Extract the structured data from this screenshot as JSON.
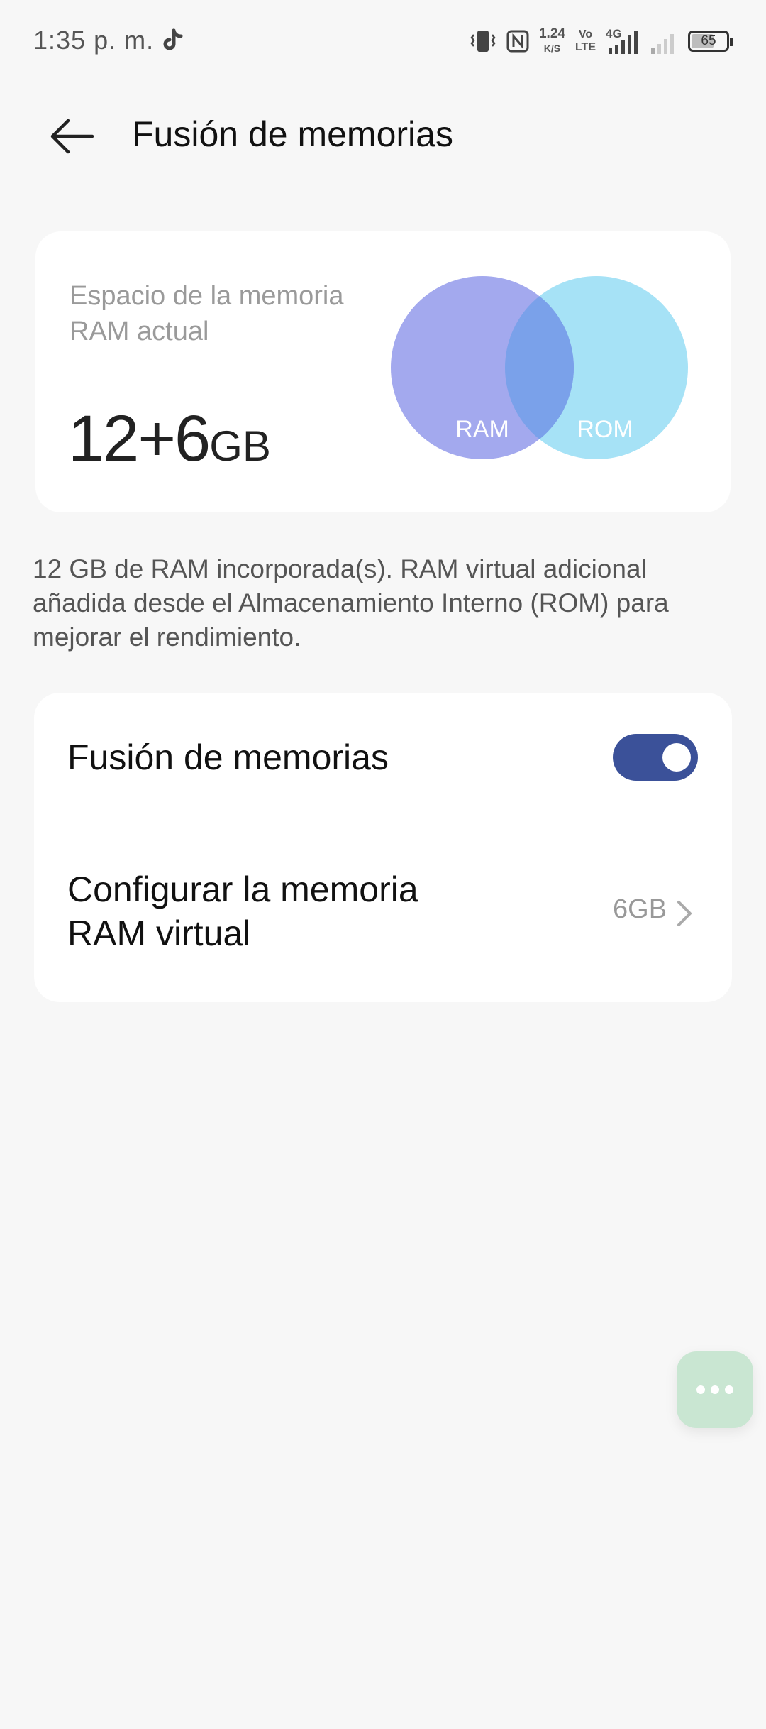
{
  "status_bar": {
    "time": "1:35 p. m.",
    "speed_value": "1.24",
    "speed_unit": "K/S",
    "volte_top": "Vo",
    "volte_bottom": "LTE",
    "network": "4G",
    "battery_level": "65",
    "icons": [
      "tiktok-icon",
      "vibrate-icon",
      "nfc-icon",
      "signal-icon",
      "signal-weak-icon",
      "battery-icon"
    ]
  },
  "header": {
    "title": "Fusión de memorias"
  },
  "memory_card": {
    "label": "Espacio de la memoria RAM actual",
    "value": "12+6",
    "unit": "GB",
    "venn_left_label": "RAM",
    "venn_right_label": "ROM",
    "colors": {
      "ram": "#a3a9ee",
      "rom": "#a6e2f6",
      "overlap": "#7aa1ea"
    }
  },
  "description": "12 GB de RAM incorporada(s). RAM virtual adicional añadida desde el Almacenamiento Interno (ROM) para mejorar el rendimiento.",
  "settings": {
    "fusion_label": "Fusión de memorias",
    "fusion_enabled": true,
    "virtual_ram_label": "Configurar la memoria RAM virtual",
    "virtual_ram_value": "6GB",
    "accent_color": "#3b5199"
  },
  "floating_button": {
    "icon": "more-dots-icon",
    "color": "#c9e6d2"
  }
}
